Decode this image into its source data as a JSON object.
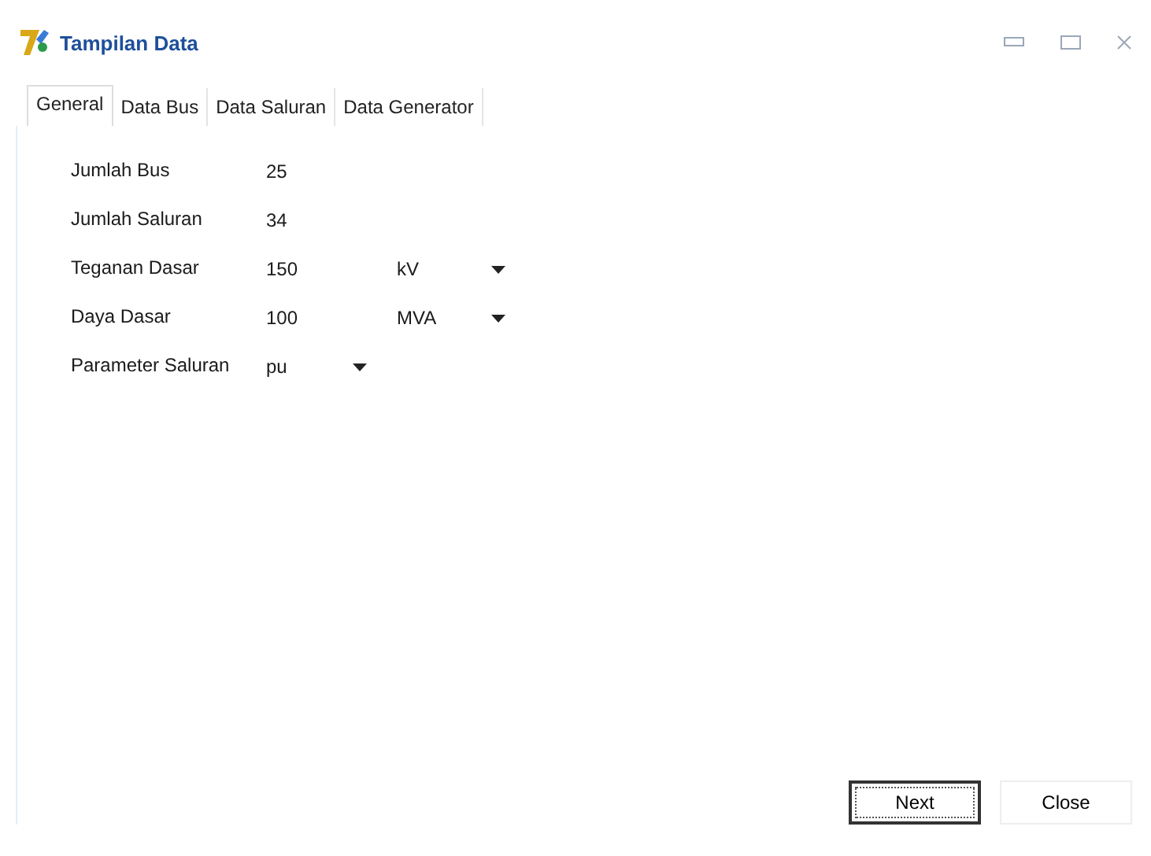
{
  "window": {
    "title": "Tampilan Data"
  },
  "tabs": [
    {
      "label": "General",
      "selected": true
    },
    {
      "label": "Data Bus",
      "selected": false
    },
    {
      "label": "Data Saluran",
      "selected": false
    },
    {
      "label": "Data Generator",
      "selected": false
    }
  ],
  "fields": [
    {
      "kind": "text",
      "label": "Jumlah Bus",
      "value": "25"
    },
    {
      "kind": "text",
      "label": "Jumlah Saluran",
      "value": "34"
    },
    {
      "kind": "text-unit",
      "label": "Teganan Dasar",
      "value": "150",
      "unit": "kV"
    },
    {
      "kind": "text-unit",
      "label": "Daya Dasar",
      "value": "100",
      "unit": "MVA"
    },
    {
      "kind": "select",
      "label": "Parameter Saluran",
      "value": "pu"
    }
  ],
  "buttons": [
    {
      "label": "Next",
      "default": true
    },
    {
      "label": "Close",
      "default": false
    }
  ]
}
